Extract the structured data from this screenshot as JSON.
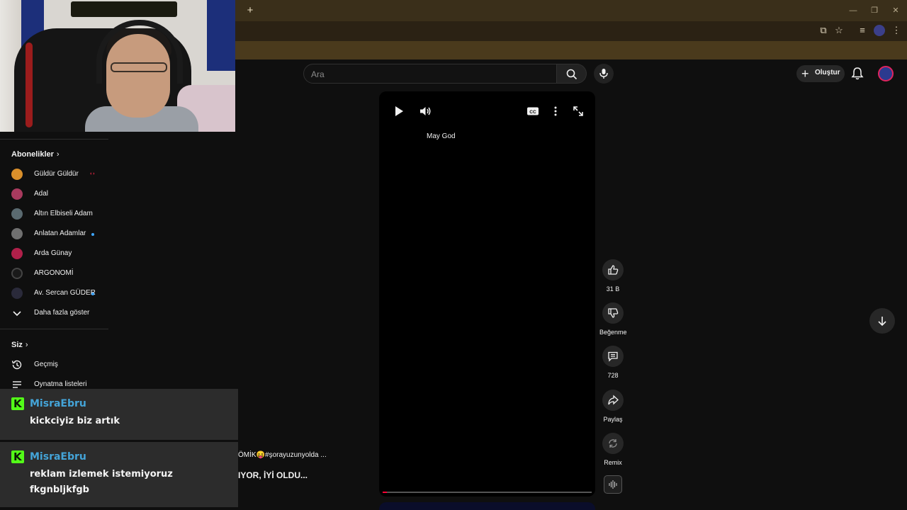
{
  "browser": {
    "new_tab_label": "+"
  },
  "search": {
    "placeholder": "Ara"
  },
  "header": {
    "create_label": "Oluştur"
  },
  "sidebar": {
    "subscriptions_title": "Abonelikler",
    "subscriptions": [
      {
        "name": "Güldür Güldür",
        "live": true,
        "new": false,
        "color": "#d98f2b"
      },
      {
        "name": "Adal",
        "live": false,
        "new": false,
        "color": "#a83a5e"
      },
      {
        "name": "Altın Elbiseli Adam",
        "live": false,
        "new": false,
        "color": "#5a6a70"
      },
      {
        "name": "Anlatan Adamlar",
        "live": false,
        "new": true,
        "color": "#707070"
      },
      {
        "name": "Arda Günay",
        "live": false,
        "new": false,
        "color": "#b0204a"
      },
      {
        "name": "ARGONOMİ",
        "live": false,
        "new": false,
        "color": "#1a1a1a"
      },
      {
        "name": "Av. Sercan GÜDER",
        "live": false,
        "new": true,
        "color": "#2a2a3a"
      }
    ],
    "show_more": "Daha fazla göster",
    "you_title": "Siz",
    "you_items": [
      {
        "label": "Geçmiş",
        "icon": "history-icon"
      },
      {
        "label": "Oynatma listeleri",
        "icon": "playlist-icon"
      }
    ]
  },
  "page_fragments": {
    "title_fragment": "ÖMİK😝#şorayuzunyolda ...",
    "title_fragment_2": "IYOR, İYİ OLDU..."
  },
  "video": {
    "caption": "May God",
    "progress": 0.02
  },
  "actions": {
    "like_count": "31 B",
    "dislike_label": "Beğenme",
    "comment_count": "728",
    "share_label": "Paylaş",
    "remix_label": "Remix"
  },
  "chat": [
    {
      "user": "MisraEbru",
      "message": "kickciyiz biz artık"
    },
    {
      "user": "MisraEbru",
      "message": "reklam izlemek istemiyoruz fkgnbljkfgb"
    }
  ],
  "colors": {
    "kick_green": "#53fc18",
    "username_blue": "#44a4d8",
    "progress_red": "#ff0033"
  }
}
